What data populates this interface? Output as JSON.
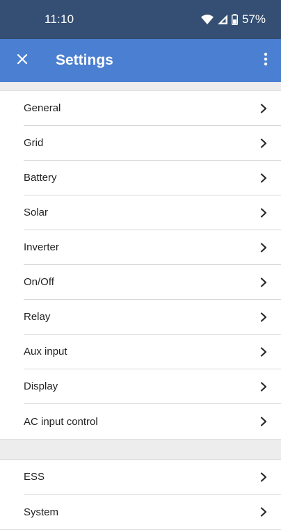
{
  "status_bar": {
    "time": "11:10",
    "battery_percent": "57%",
    "icons": [
      "wifi-icon",
      "cell-signal-icon",
      "battery-icon"
    ]
  },
  "app_bar": {
    "title": "Settings",
    "close_icon": "close-icon",
    "menu_icon": "more-vert-icon"
  },
  "groups": [
    {
      "items": [
        {
          "label": "General"
        },
        {
          "label": "Grid"
        },
        {
          "label": "Battery"
        },
        {
          "label": "Solar"
        },
        {
          "label": "Inverter"
        },
        {
          "label": "On/Off"
        },
        {
          "label": "Relay"
        },
        {
          "label": "Aux input"
        },
        {
          "label": "Display"
        },
        {
          "label": "AC input control"
        }
      ]
    },
    {
      "items": [
        {
          "label": "ESS"
        },
        {
          "label": "System"
        }
      ]
    }
  ],
  "colors": {
    "status_bar": "#344f73",
    "app_bar": "#4a7fd1",
    "background": "#ededed"
  }
}
